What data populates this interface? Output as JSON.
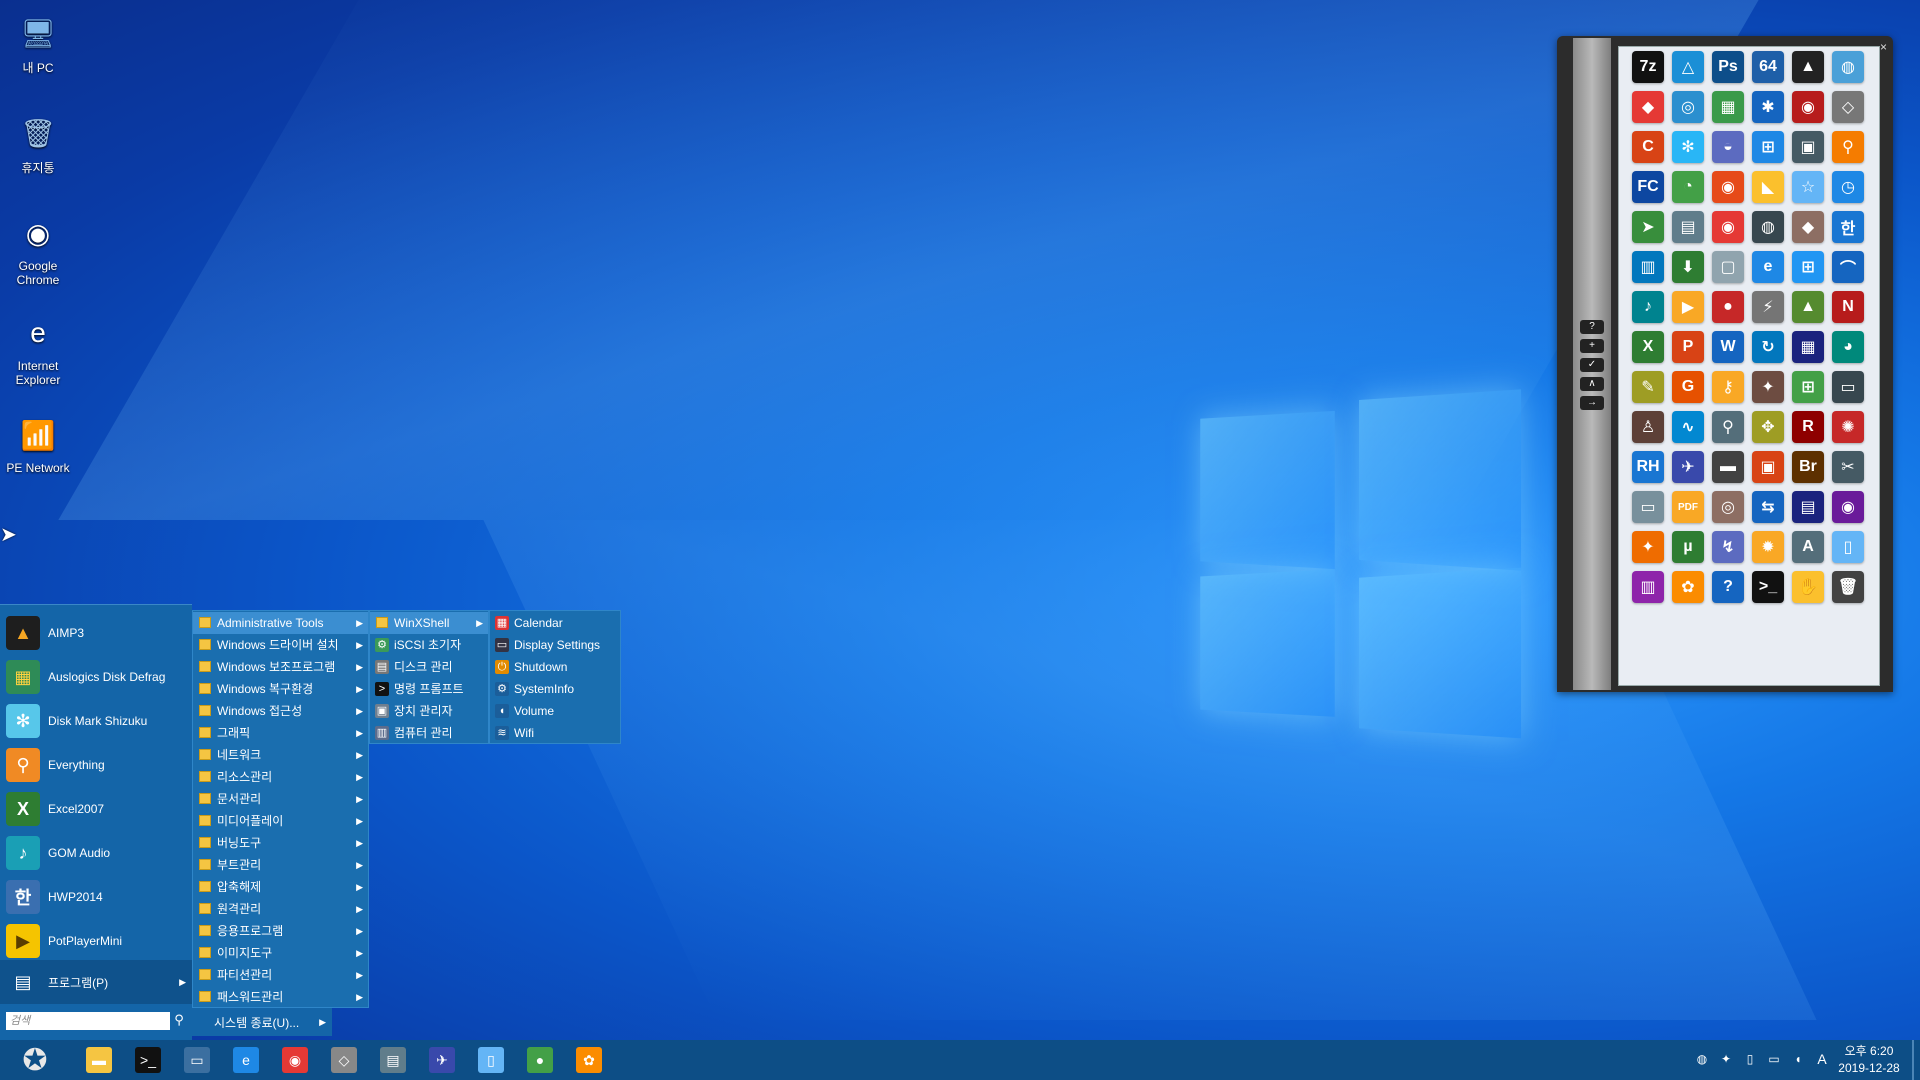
{
  "desktop": {
    "icons": [
      {
        "label": "내 PC",
        "icon": "computer-icon",
        "glyph": "🖥",
        "color": "#7fb6e8"
      },
      {
        "label": "휴지통",
        "icon": "recycle-bin-icon",
        "glyph": "🗑",
        "color": "#9ec3e6"
      },
      {
        "label": "Google Chrome",
        "icon": "chrome-icon",
        "glyph": "◉",
        "color": "#ffffff"
      },
      {
        "label": "Internet Explorer",
        "icon": "ie-icon",
        "glyph": "e",
        "color": "#ffffff"
      },
      {
        "label": "PE Network",
        "icon": "network-icon",
        "glyph": "📶",
        "color": "#c8d4e0"
      }
    ]
  },
  "start_menu": {
    "pinned": [
      {
        "label": "AIMP3",
        "icon": "aimp-icon",
        "glyph": "▲",
        "color": "#1e1e1e",
        "fg": "#f5a623"
      },
      {
        "label": "Auslogics Disk Defrag",
        "icon": "defrag-icon",
        "glyph": "▦",
        "color": "#2e8b57",
        "fg": "#ffd23f"
      },
      {
        "label": "Disk Mark Shizuku",
        "icon": "diskmark-icon",
        "glyph": "✻",
        "color": "#57c7ea",
        "fg": "#ffffff"
      },
      {
        "label": "Everything",
        "icon": "search-everything-icon",
        "glyph": "⚲",
        "color": "#f08a24",
        "fg": "#ffffff"
      },
      {
        "label": "Excel2007",
        "icon": "excel-icon",
        "glyph": "X",
        "color": "#2e7d32",
        "fg": "#ffffff"
      },
      {
        "label": "GOM Audio",
        "icon": "gom-audio-icon",
        "glyph": "♪",
        "color": "#1a9fb5",
        "fg": "#ffffff"
      },
      {
        "label": "HWP2014",
        "icon": "hwp-icon",
        "glyph": "한",
        "color": "#3a6fb0",
        "fg": "#ffffff"
      },
      {
        "label": "PotPlayerMini",
        "icon": "potplayer-icon",
        "glyph": "▶",
        "color": "#f5c400",
        "fg": "#5a3d00"
      }
    ],
    "programs_label": "프로그램(P)",
    "search_placeholder": "검색",
    "shutdown_label": "시스템 종료(U)..."
  },
  "menu_programs": [
    "Administrative Tools",
    "Windows 드라이버 설치",
    "Windows 보조프로그램",
    "Windows 복구환경",
    "Windows 접근성",
    "그래픽",
    "네트워크",
    "리소스관리",
    "문서관리",
    "미디어플레이",
    "버닝도구",
    "부트관리",
    "압축해제",
    "원격관리",
    "응용프로그램",
    "이미지도구",
    "파티션관리",
    "패스워드관리"
  ],
  "menu_admin": [
    {
      "label": "WinXShell",
      "folder": true
    },
    {
      "label": "iSCSI 초기자",
      "glyph": "⚙",
      "color": "#3b9a59"
    },
    {
      "label": "디스크 관리",
      "glyph": "▤",
      "color": "#777"
    },
    {
      "label": "명령 프롬프트",
      "glyph": ">",
      "color": "#111"
    },
    {
      "label": "장치 관리자",
      "glyph": "▣",
      "color": "#6f7f8f"
    },
    {
      "label": "컴퓨터 관리",
      "glyph": "▥",
      "color": "#5c6c8c"
    }
  ],
  "menu_winxshell": [
    {
      "label": "Calendar",
      "glyph": "▦",
      "color": "#d33"
    },
    {
      "label": "Display Settings",
      "glyph": "▭",
      "color": "#334"
    },
    {
      "label": "Shutdown",
      "glyph": "⏻",
      "color": "#e28b00"
    },
    {
      "label": "SystemInfo",
      "glyph": "⚙",
      "color": "#1b5e9a"
    },
    {
      "label": "Volume",
      "glyph": "◖",
      "color": "#1b5e9a"
    },
    {
      "label": "Wifi",
      "glyph": "≋",
      "color": "#1b5e9a"
    }
  ],
  "dock": {
    "close_label": "×",
    "side_buttons": [
      "?",
      "+",
      "✓",
      "∧",
      "→"
    ],
    "icons": [
      {
        "n": "7zip-icon",
        "g": "7z",
        "c": "#111"
      },
      {
        "n": "triangle-app-icon",
        "g": "△",
        "c": "#1b8fd6"
      },
      {
        "n": "photoshop-icon",
        "g": "Ps",
        "c": "#0d4e8a"
      },
      {
        "n": "aida64-icon",
        "g": "64",
        "c": "#1e5fa8"
      },
      {
        "n": "aimp-icon",
        "g": "▲",
        "c": "#222"
      },
      {
        "n": "globe-tool-icon",
        "g": "◍",
        "c": "#4aa0d8"
      },
      {
        "n": "anydesk-icon",
        "g": "◆",
        "c": "#e53935"
      },
      {
        "n": "backup-icon",
        "g": "◎",
        "c": "#2b8fcf"
      },
      {
        "n": "defrag-icon",
        "g": "▦",
        "c": "#3a9a4a"
      },
      {
        "n": "bluetooth-icon",
        "g": "✱",
        "c": "#1565c0"
      },
      {
        "n": "burn-disc-icon",
        "g": "◉",
        "c": "#b71c1c"
      },
      {
        "n": "bootice-icon",
        "g": "◇",
        "c": "#777"
      },
      {
        "n": "ccleaner-icon",
        "g": "C",
        "c": "#d84315"
      },
      {
        "n": "diskmark-icon",
        "g": "✻",
        "c": "#29b6f6"
      },
      {
        "n": "disk-tool-icon",
        "g": "◒",
        "c": "#5c6bc0"
      },
      {
        "n": "windows-icon",
        "g": "⊞",
        "c": "#1e88e5"
      },
      {
        "n": "pc-tool-icon",
        "g": "▣",
        "c": "#455a64"
      },
      {
        "n": "everything-icon",
        "g": "⚲",
        "c": "#f57c00"
      },
      {
        "n": "fastcopy-icon",
        "g": "FC",
        "c": "#0d47a1"
      },
      {
        "n": "partition-pie-icon",
        "g": "◔",
        "c": "#43a047"
      },
      {
        "n": "eye-tool-icon",
        "g": "◉",
        "c": "#e64a19"
      },
      {
        "n": "yellow-tool-icon",
        "g": "◣",
        "c": "#fbc02d"
      },
      {
        "n": "star-tool-icon",
        "g": "☆",
        "c": "#64b5f6"
      },
      {
        "n": "clock-tool-icon",
        "g": "◷",
        "c": "#1e88e5"
      },
      {
        "n": "arrow-tool-icon",
        "g": "➤",
        "c": "#388e3c"
      },
      {
        "n": "printer-icon",
        "g": "▤",
        "c": "#607d8b"
      },
      {
        "n": "chrome-icon",
        "g": "◉",
        "c": "#e53935"
      },
      {
        "n": "disk-info-icon",
        "g": "◍",
        "c": "#37474f"
      },
      {
        "n": "drive-icon",
        "g": "◆",
        "c": "#8d6e63"
      },
      {
        "n": "hwp-icon",
        "g": "한",
        "c": "#1976d2"
      },
      {
        "n": "equalizer-icon",
        "g": "▥",
        "c": "#0277bd"
      },
      {
        "n": "download-icon",
        "g": "⬇",
        "c": "#2e7d32"
      },
      {
        "n": "files-icon",
        "g": "▢",
        "c": "#90a4ae"
      },
      {
        "n": "ie-icon",
        "g": "e",
        "c": "#1e88e5"
      },
      {
        "n": "windows-flag-icon",
        "g": "⊞",
        "c": "#2196f3"
      },
      {
        "n": "feather-icon",
        "g": "⌒",
        "c": "#1565c0"
      },
      {
        "n": "gom-audio-icon",
        "g": "♪",
        "c": "#00838f"
      },
      {
        "n": "potplayer-icon",
        "g": "▶",
        "c": "#f9a825"
      },
      {
        "n": "car-icon",
        "g": "●",
        "c": "#c62828"
      },
      {
        "n": "usb-tool-icon",
        "g": "⚡",
        "c": "#757575"
      },
      {
        "n": "chart-tool-icon",
        "g": "▲",
        "c": "#558b2f"
      },
      {
        "n": "np-tool-icon",
        "g": "N",
        "c": "#b71c1c"
      },
      {
        "n": "excel-icon",
        "g": "X",
        "c": "#2e7d32"
      },
      {
        "n": "powerpoint-icon",
        "g": "P",
        "c": "#d84315"
      },
      {
        "n": "word-icon",
        "g": "W",
        "c": "#1565c0"
      },
      {
        "n": "sync-icon",
        "g": "↻",
        "c": "#0277bd"
      },
      {
        "n": "grid-tool-icon",
        "g": "▦",
        "c": "#1a237e"
      },
      {
        "n": "partition-icon",
        "g": "◕",
        "c": "#00897b"
      },
      {
        "n": "pen-tool-icon",
        "g": "✎",
        "c": "#9e9d24"
      },
      {
        "n": "g-tool-icon",
        "g": "G",
        "c": "#e65100"
      },
      {
        "n": "key-icon",
        "g": "⚷",
        "c": "#f9a825"
      },
      {
        "n": "network-tool-icon",
        "g": "✦",
        "c": "#6d4c41"
      },
      {
        "n": "windows-setup-icon",
        "g": "⊞",
        "c": "#43a047"
      },
      {
        "n": "monitor-icon",
        "g": "▭",
        "c": "#37474f"
      },
      {
        "n": "stamp-icon",
        "g": "♙",
        "c": "#5d4037"
      },
      {
        "n": "pulse-icon",
        "g": "∿",
        "c": "#0288d1"
      },
      {
        "n": "magnifier-icon",
        "g": "⚲",
        "c": "#546e7a"
      },
      {
        "n": "puzzle-icon",
        "g": "✥",
        "c": "#9e9d24"
      },
      {
        "n": "r-tool-icon",
        "g": "R",
        "c": "#8e0000"
      },
      {
        "n": "virus-icon",
        "g": "✺",
        "c": "#c62828"
      },
      {
        "n": "rh-icon",
        "g": "RH",
        "c": "#1976d2"
      },
      {
        "n": "wrench-tool-icon",
        "g": "✈",
        "c": "#3949ab"
      },
      {
        "n": "usb-drive-icon",
        "g": "▬",
        "c": "#424242"
      },
      {
        "n": "box-icon",
        "g": "▣",
        "c": "#d84315"
      },
      {
        "n": "bridge-icon",
        "g": "Br",
        "c": "#5d3000"
      },
      {
        "n": "screenshot-icon",
        "g": "✂",
        "c": "#455a64"
      },
      {
        "n": "scanner-icon",
        "g": "▭",
        "c": "#78909c"
      },
      {
        "n": "pdf-icon",
        "g": "PDF",
        "c": "#f9a825"
      },
      {
        "n": "cd-tool-icon",
        "g": "◎",
        "c": "#8d6e63"
      },
      {
        "n": "teamviewer-icon",
        "g": "⇆",
        "c": "#1565c0"
      },
      {
        "n": "save-icon",
        "g": "▤",
        "c": "#1a237e"
      },
      {
        "n": "dvd-icon",
        "g": "◉",
        "c": "#6a1b9a"
      },
      {
        "n": "wand-icon",
        "g": "✦",
        "c": "#ef6c00"
      },
      {
        "n": "utorrent-icon",
        "g": "µ",
        "c": "#2e7d32"
      },
      {
        "n": "vpn-icon",
        "g": "↯",
        "c": "#5c6bc0"
      },
      {
        "n": "gear-gold-icon",
        "g": "✹",
        "c": "#f9a825"
      },
      {
        "n": "notepad-icon",
        "g": "A",
        "c": "#546e7a"
      },
      {
        "n": "document-icon",
        "g": "▯",
        "c": "#64b5f6"
      },
      {
        "n": "winrar-icon",
        "g": "▥",
        "c": "#8e24aa"
      },
      {
        "n": "paint-icon",
        "g": "✿",
        "c": "#fb8c00"
      },
      {
        "n": "help-icon",
        "g": "?",
        "c": "#1565c0"
      },
      {
        "n": "terminal-icon",
        "g": ">_",
        "c": "#111"
      },
      {
        "n": "hand-tool-icon",
        "g": "✋",
        "c": "#fbc02d"
      },
      {
        "n": "trash-icon",
        "g": "🗑",
        "c": "#424242"
      }
    ]
  },
  "taskbar": {
    "apps": [
      {
        "n": "file-explorer-icon",
        "g": "▬",
        "c": "#f5c542"
      },
      {
        "n": "terminal-icon",
        "g": ">_",
        "c": "#111"
      },
      {
        "n": "network-monitor-icon",
        "g": "▭",
        "c": "#3b6fa0"
      },
      {
        "n": "ie-icon",
        "g": "e",
        "c": "#1e88e5"
      },
      {
        "n": "chrome-icon",
        "g": "◉",
        "c": "#e53935"
      },
      {
        "n": "bootice-icon",
        "g": "◇",
        "c": "#888"
      },
      {
        "n": "printer-tool-icon",
        "g": "▤",
        "c": "#607d8b"
      },
      {
        "n": "wrench-tool-icon",
        "g": "✈",
        "c": "#3949ab"
      },
      {
        "n": "document-icon",
        "g": "▯",
        "c": "#64b5f6"
      },
      {
        "n": "green-tool-icon",
        "g": "●",
        "c": "#43a047"
      },
      {
        "n": "paint-icon",
        "g": "✿",
        "c": "#fb8c00"
      }
    ],
    "tray": [
      {
        "n": "tray-app-icon",
        "g": "◍"
      },
      {
        "n": "tray-network-tool-icon",
        "g": "✦"
      },
      {
        "n": "tray-usb-icon",
        "g": "▯"
      },
      {
        "n": "tray-network-icon",
        "g": "▭"
      },
      {
        "n": "tray-volume-icon",
        "g": "◖"
      }
    ],
    "ime_label": "A",
    "time": "오후 6:20",
    "date": "2019-12-28"
  }
}
